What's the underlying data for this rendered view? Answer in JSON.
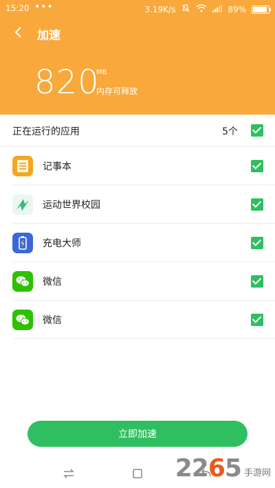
{
  "status_bar": {
    "time": "15:20",
    "dots": "•••",
    "network_speed": "3.19K/s",
    "battery_level": "89%",
    "battery_fraction": 0.89
  },
  "toolbar": {
    "back_icon": "chevron-left-icon",
    "title": "加速"
  },
  "memory": {
    "value": "820",
    "unit": "MB",
    "description": "内存可释放"
  },
  "list": {
    "header_label": "正在运行的应用",
    "count": "5个",
    "select_all_checked": true,
    "apps": [
      {
        "name": "记事本",
        "icon": "notepad-icon",
        "checked": true
      },
      {
        "name": "运动世界校园",
        "icon": "sports-campus-icon",
        "checked": true
      },
      {
        "name": "充电大师",
        "icon": "charge-master-icon",
        "checked": true
      },
      {
        "name": "微信",
        "icon": "wechat-icon",
        "checked": true
      },
      {
        "name": "微信",
        "icon": "wechat-icon",
        "checked": true
      }
    ]
  },
  "speed_button_label": "立即加速",
  "watermark": {
    "digits_a": "22",
    "digit_accent": "6",
    "digits_b": "5",
    "site": "手游网"
  },
  "colors": {
    "header": "#f9a83b",
    "accent_green": "#2fbf61"
  }
}
